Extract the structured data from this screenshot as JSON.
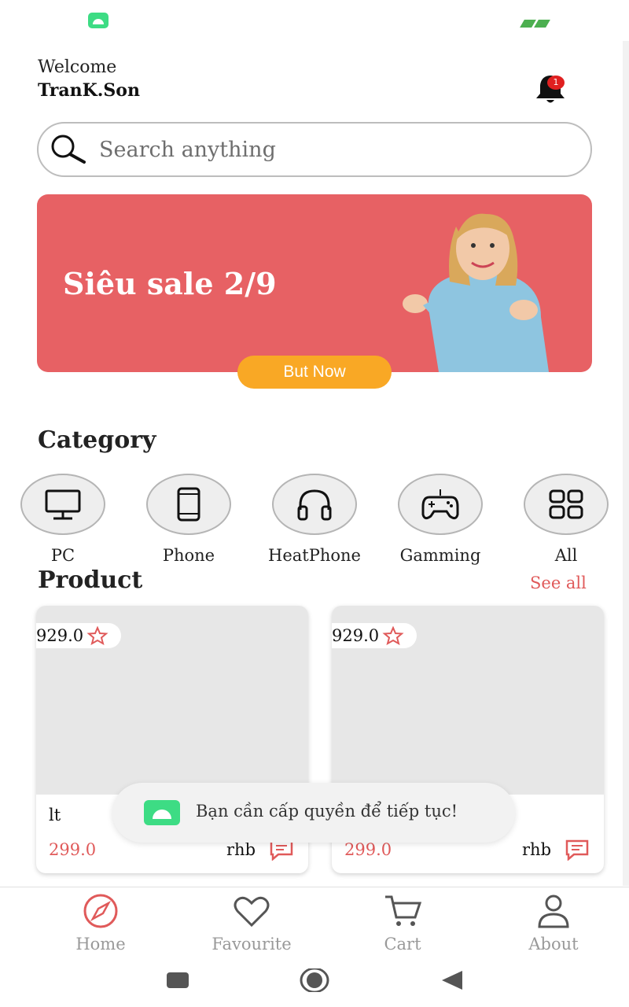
{
  "header": {
    "welcome": "Welcome",
    "username": "TranK.Son",
    "notification_count": "1"
  },
  "search": {
    "placeholder": "Search anything"
  },
  "banner": {
    "title": "Siêu sale 2/9",
    "button_label": "But Now"
  },
  "category": {
    "title": "Category",
    "items": [
      {
        "label": "PC",
        "icon": "monitor-icon"
      },
      {
        "label": "Phone",
        "icon": "phone-icon"
      },
      {
        "label": "HeatPhone",
        "icon": "headphones-icon"
      },
      {
        "label": "Gamming",
        "icon": "gamepad-icon"
      },
      {
        "label": "All",
        "icon": "grid-icon"
      }
    ]
  },
  "product": {
    "title": "Product",
    "see_all": "See all",
    "items": [
      {
        "rating": "929.0",
        "name": "lt",
        "price": "299.0",
        "unit": "rhb"
      },
      {
        "rating": "929.0",
        "name": "",
        "price": "299.0",
        "unit": "rhb"
      }
    ]
  },
  "toast": {
    "message": "Bạn cần cấp quyền để tiếp tục!"
  },
  "bottom_nav": {
    "items": [
      {
        "label": "Home",
        "icon": "compass-icon",
        "active": true
      },
      {
        "label": "Favourite",
        "icon": "heart-icon",
        "active": false
      },
      {
        "label": "Cart",
        "icon": "cart-icon",
        "active": false
      },
      {
        "label": "About",
        "icon": "user-icon",
        "active": false
      }
    ]
  },
  "colors": {
    "accent": "#e05a5a",
    "banner": "#e76164",
    "buy_button": "#f9a825",
    "android_green": "#3ddc84"
  }
}
